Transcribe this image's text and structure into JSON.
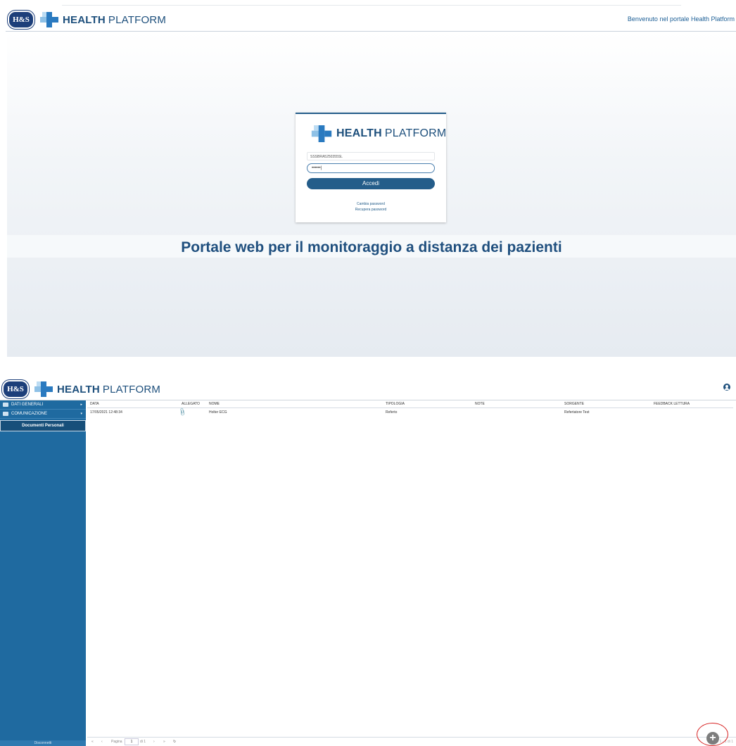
{
  "login": {
    "brand_bold": "HEALTH",
    "brand_light": "PLATFORM",
    "badge": "H&S",
    "welcome": "Benvenuto nel portale Health Platform",
    "username_value": "SSSBRA5250355SL",
    "password_value": "••••••|",
    "login_button": "Accedi",
    "change_password": "Cambia password",
    "recover_password": "Recupera password",
    "tagline": "Portale web per il monitoraggio a distanza dei pazienti"
  },
  "app": {
    "badge": "H&S",
    "brand_bold": "HEALTH",
    "brand_light": "PLATFORM",
    "sidebar": {
      "items": [
        {
          "label": "DATI GENERALI",
          "arrow": "▸"
        },
        {
          "label": "COMUNICAZIONE",
          "arrow": "▾"
        }
      ],
      "subitem": "Documenti Personali",
      "logout": "Disconnetti"
    },
    "columns": [
      "DATA",
      "ALLEGATO",
      "NOME",
      "TIPOLOGIA",
      "NOTE",
      "SORGENTE",
      "FEEDBACK LETTURA"
    ],
    "rows": [
      {
        "data": "17/05/2021 12:48:34",
        "nome": "Holter ECG",
        "tipologia": "Referto",
        "note": "",
        "sorgente": "Refertatore Test",
        "feedback": ""
      }
    ],
    "pager": {
      "first": "«",
      "prev": "‹",
      "page_label": "Pagina",
      "page_value": "1",
      "of_label": "di 1",
      "next": "›",
      "last": "»",
      "refresh": "↻",
      "summary": "Visibili 1 - 1 di 1"
    },
    "add_button": "+"
  },
  "colors": {
    "primary": "#1f6aa0",
    "dark_blue": "#1d4f7c",
    "highlight": "#d72222"
  }
}
